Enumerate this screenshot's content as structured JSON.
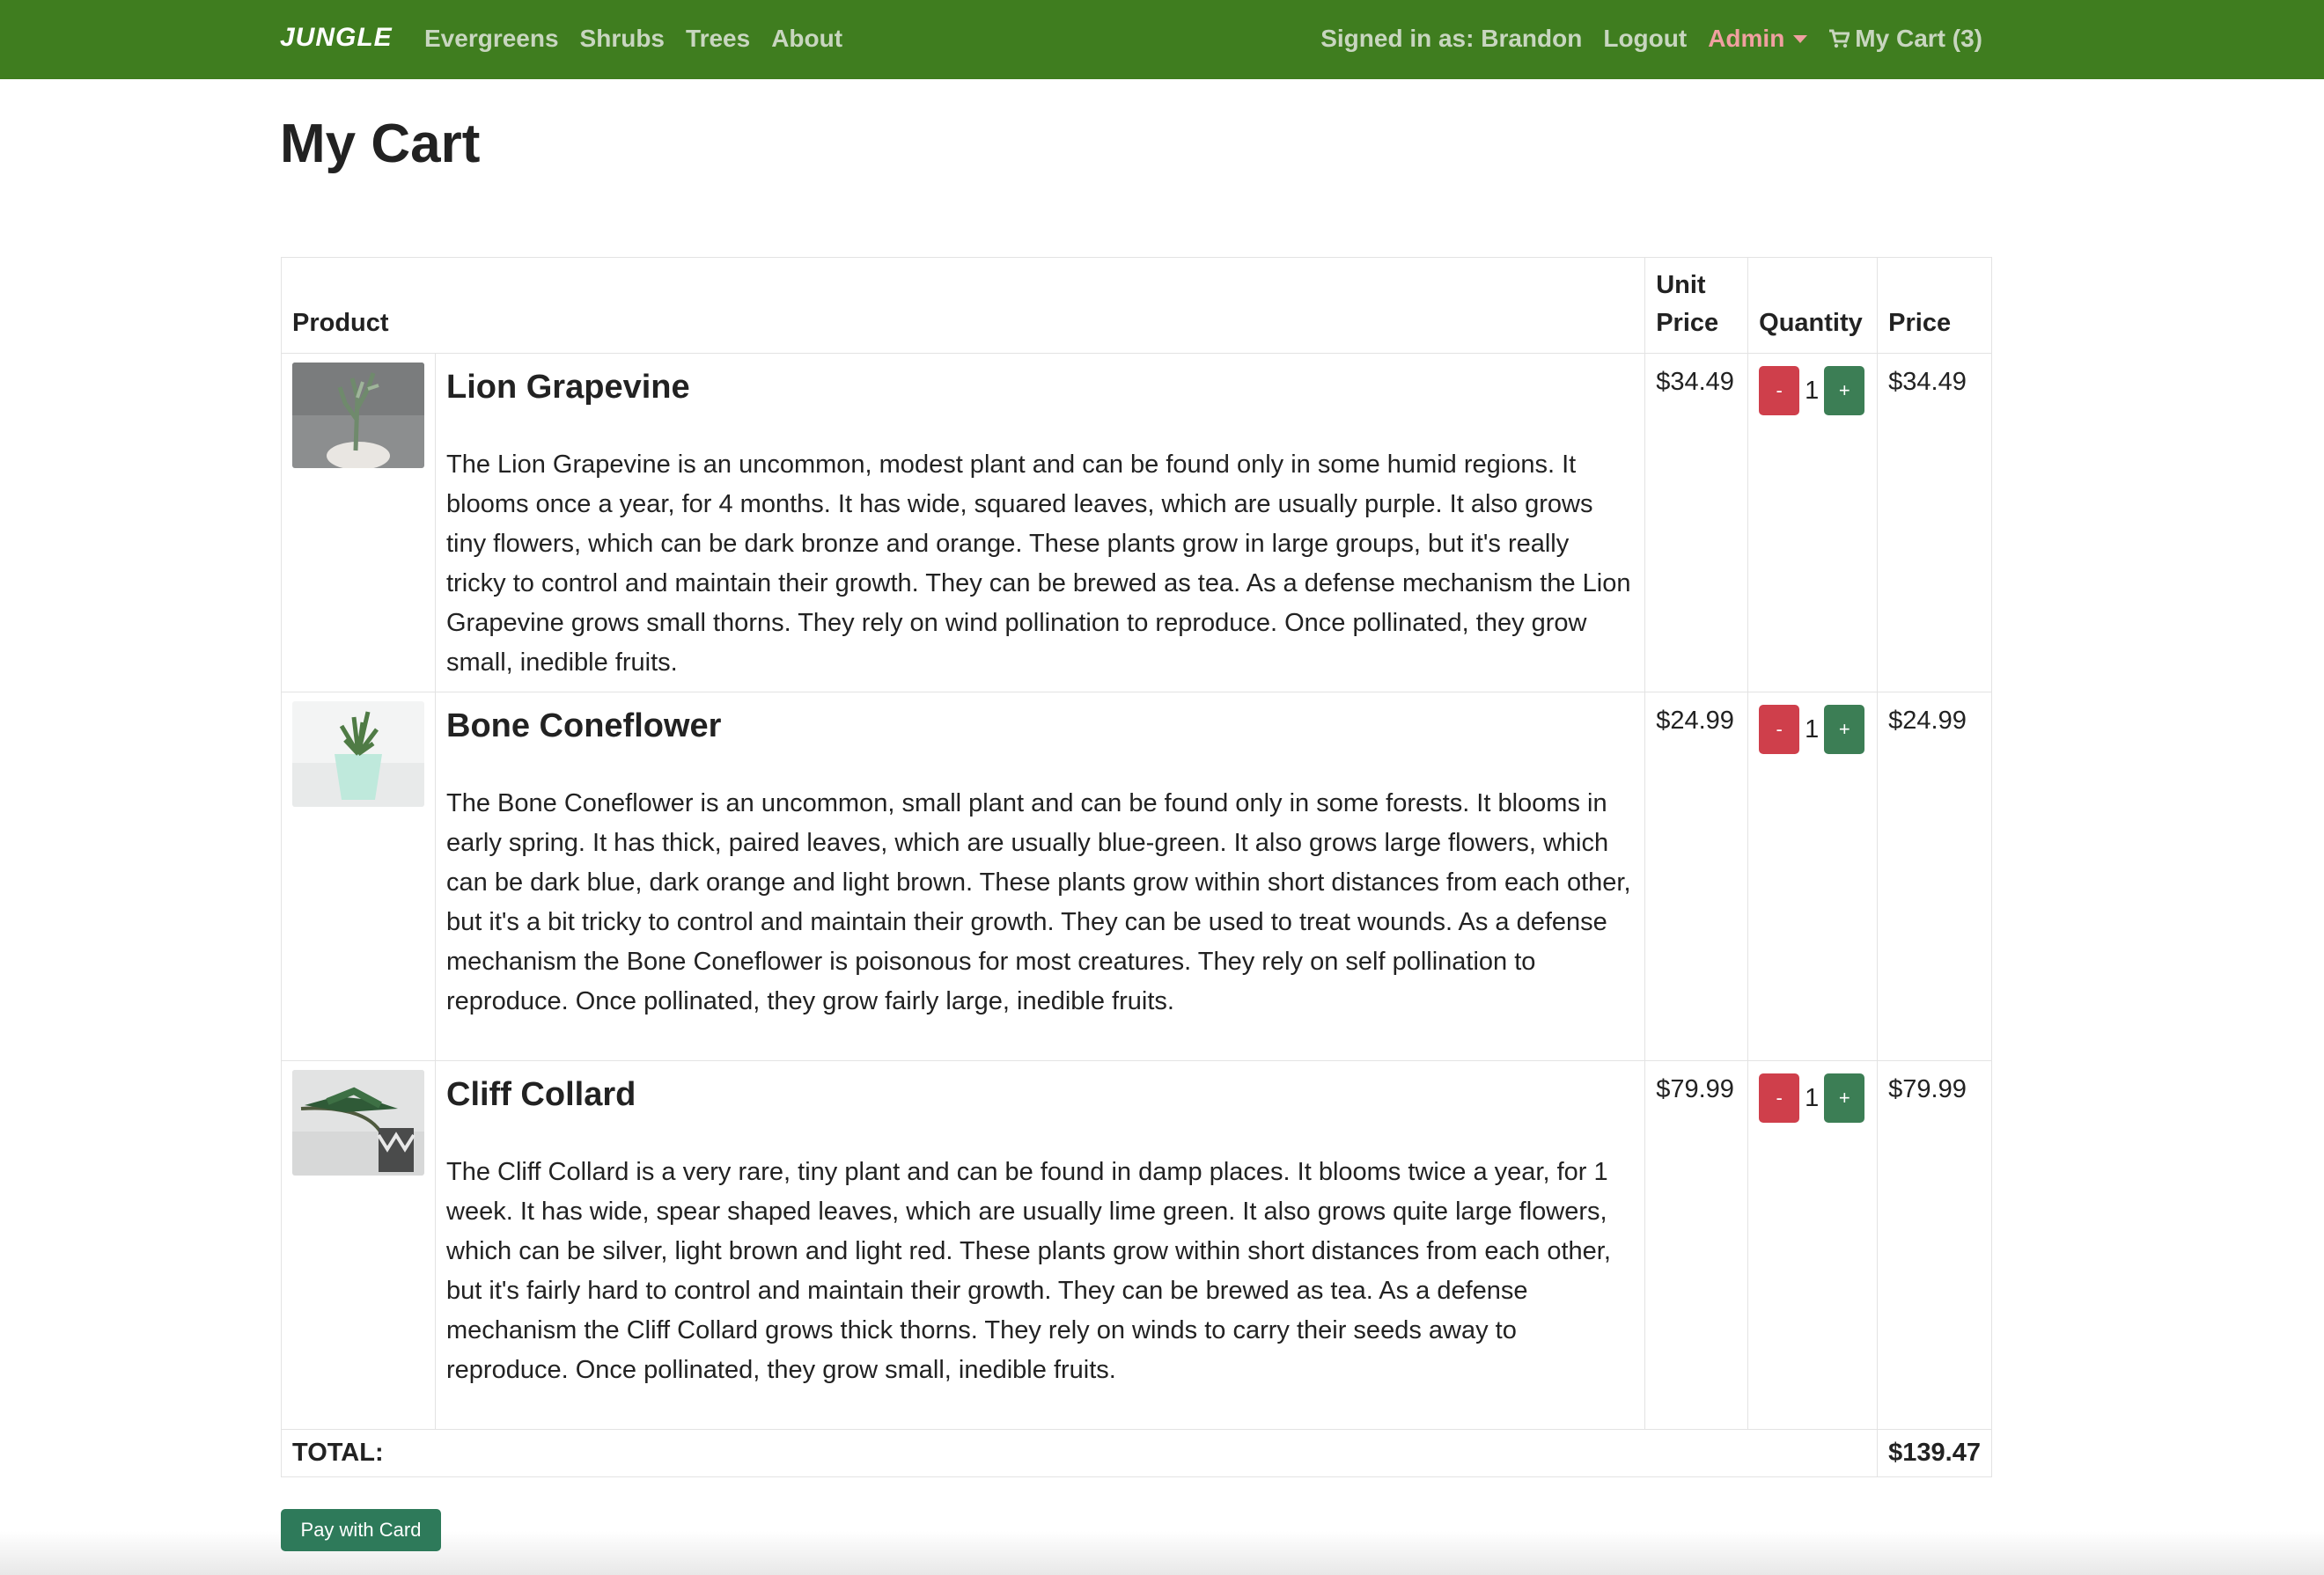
{
  "nav": {
    "brand": "JUNGLE",
    "links": [
      "Evergreens",
      "Shrubs",
      "Trees",
      "About"
    ],
    "signed_in": "Signed in as: Brandon",
    "logout": "Logout",
    "admin": "Admin",
    "cart": "My Cart (3)",
    "cart_icon": "shopping-cart-icon"
  },
  "page": {
    "title": "My Cart"
  },
  "table": {
    "headers": {
      "product": "Product",
      "unit_price_1": "Unit",
      "unit_price_2": "Price",
      "quantity": "Quantity",
      "price": "Price"
    },
    "items": [
      {
        "name": "Lion Grapevine",
        "description": "The Lion Grapevine is an uncommon, modest plant and can be found only in some humid regions. It blooms once a year, for 4 months. It has wide, squared leaves, which are usually purple. It also grows tiny flowers, which can be dark bronze and orange. These plants grow in large groups, but it's really tricky to control and maintain their growth. They can be brewed as tea. As a defense mechanism the Lion Grapevine grows small thorns. They rely on wind pollination to reproduce. Once pollinated, they grow small, inedible fruits.",
        "unit_price": "$34.49",
        "quantity": "1",
        "price": "$34.49",
        "minus": "-",
        "plus": "+"
      },
      {
        "name": "Bone Coneflower",
        "description": "The Bone Coneflower is an uncommon, small plant and can be found only in some forests. It blooms in early spring. It has thick, paired leaves, which are usually blue-green. It also grows large flowers, which can be dark blue, dark orange and light brown. These plants grow within short distances from each other, but it's a bit tricky to control and maintain their growth. They can be used to treat wounds. As a defense mechanism the Bone Coneflower is poisonous for most creatures. They rely on self pollination to reproduce. Once pollinated, they grow fairly large, inedible fruits.",
        "unit_price": "$24.99",
        "quantity": "1",
        "price": "$24.99",
        "minus": "-",
        "plus": "+"
      },
      {
        "name": "Cliff Collard",
        "description": "The Cliff Collard is a very rare, tiny plant and can be found in damp places. It blooms twice a year, for 1 week. It has wide, spear shaped leaves, which are usually lime green. It also grows quite large flowers, which can be silver, light brown and light red. These plants grow within short distances from each other, but it's fairly hard to control and maintain their growth. They can be brewed as tea. As a defense mechanism the Cliff Collard grows thick thorns. They rely on winds to carry their seeds away to reproduce. Once pollinated, they grow small, inedible fruits.",
        "unit_price": "$79.99",
        "quantity": "1",
        "price": "$79.99",
        "minus": "-",
        "plus": "+"
      }
    ],
    "total_label": "TOTAL:",
    "total_value": "$139.47"
  },
  "pay_button": "Pay with Card",
  "colors": {
    "navbar": "#3f7d1f",
    "minus": "#cf3f4b",
    "plus": "#3c7e55",
    "pay": "#2e7a5a"
  }
}
